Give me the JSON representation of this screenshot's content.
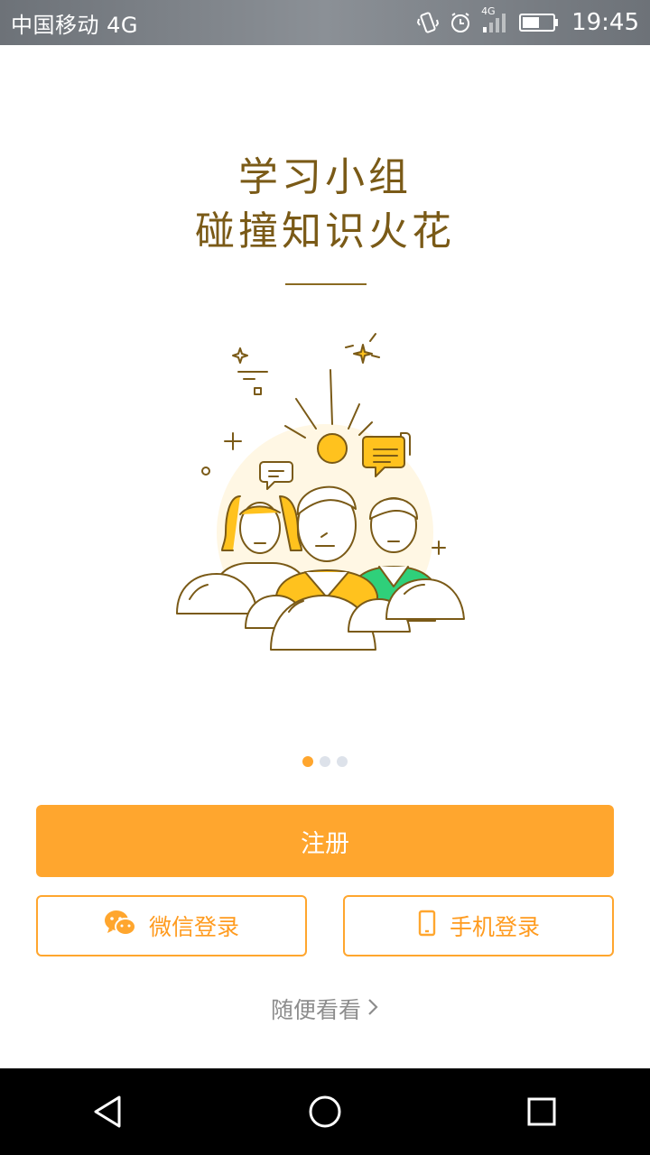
{
  "status_bar": {
    "carrier": "中国移动 4G",
    "network_badge": "4G",
    "time": "19:45",
    "icons": [
      "vibrate-icon",
      "alarm-icon",
      "signal-icon",
      "battery-icon"
    ]
  },
  "hero": {
    "title_line1": "学习小组",
    "title_line2": "碰撞知识火花"
  },
  "pager": {
    "count": 3,
    "active_index": 0
  },
  "actions": {
    "register_label": "注册",
    "wechat_login_label": "微信登录",
    "phone_login_label": "手机登录",
    "browse_label": "随便看看"
  },
  "colors": {
    "accent": "#ffa62e",
    "title": "#7a5a17",
    "status_bar": "#7c8187",
    "nav_bar": "#000000"
  },
  "nav_bar": {
    "icons": [
      "back-icon",
      "home-icon",
      "recents-icon"
    ]
  }
}
